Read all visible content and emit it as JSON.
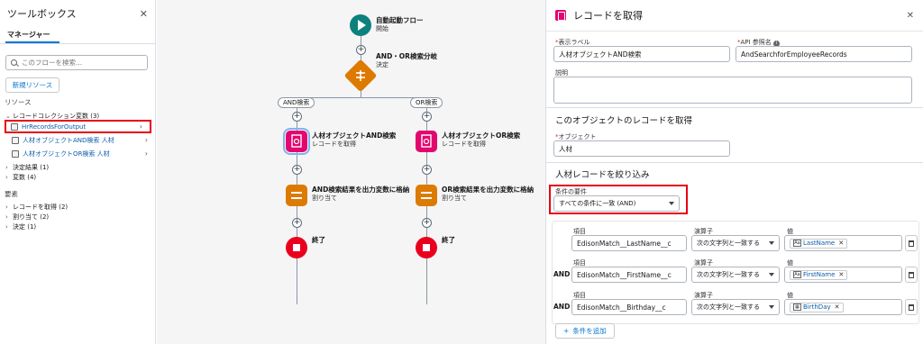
{
  "toolbox": {
    "title": "ツールボックス",
    "tab": "マネージャー",
    "search_placeholder": "このフローを検索...",
    "new_resource": "新規リソース",
    "resources_label": "リソース",
    "collection_group": "レコードコレクション変数 (3)",
    "collection_items": [
      "HrRecordsForOutput",
      "人材オブジェクトAND検索 人材",
      "人材オブジェクトOR検索 人材"
    ],
    "decision_results": "決定結果 (1)",
    "variables": "変数 (4)",
    "elements_label": "要素",
    "elements": [
      "レコードを取得 (2)",
      "割り当て (2)",
      "決定 (1)"
    ]
  },
  "canvas": {
    "start_title": "自動起動フロー",
    "start_sub": "開始",
    "decision_title": "AND・OR検索分岐",
    "decision_sub": "決定",
    "and_branch": "AND検索",
    "or_branch": "OR検索",
    "and_get_title": "人材オブジェクトAND検索",
    "and_get_sub": "レコードを取得",
    "or_get_title": "人材オブジェクトOR検索",
    "or_get_sub": "レコードを取得",
    "and_assign_title": "AND検索結果を出力変数に格納",
    "and_assign_sub": "割り当て",
    "or_assign_title": "OR検索結果を出力変数に格納",
    "or_assign_sub": "割り当て",
    "end_label": "終了",
    "plus": "+"
  },
  "panel": {
    "title": "レコードを取得",
    "label_label": "表示ラベル",
    "label_value": "人材オブジェクトAND検索",
    "api_label": "API 参照名",
    "api_value": "AndSearchforEmployeeRecords",
    "desc_label": "説明",
    "section_get": "このオブジェクトのレコードを取得",
    "object_label": "オブジェクト",
    "object_value": "人材",
    "section_filter": "人材レコードを絞り込み",
    "condition_label": "条件の要件",
    "condition_value": "すべての条件に一致 (AND)",
    "col_field": "項目",
    "col_operator": "演算子",
    "col_value": "値",
    "and_word": "AND",
    "rows": [
      {
        "field": "EdisonMatch__LastName__c",
        "op": "次の文字列と一致する",
        "value": "LastName",
        "icon": "Aa"
      },
      {
        "field": "EdisonMatch__FirstName__c",
        "op": "次の文字列と一致する",
        "value": "FirstName",
        "icon": "Aa"
      },
      {
        "field": "EdisonMatch__Birthday__c",
        "op": "次の文字列と一致する",
        "value": "BirthDay",
        "icon": "▦"
      }
    ],
    "add_condition": "条件を追加"
  }
}
